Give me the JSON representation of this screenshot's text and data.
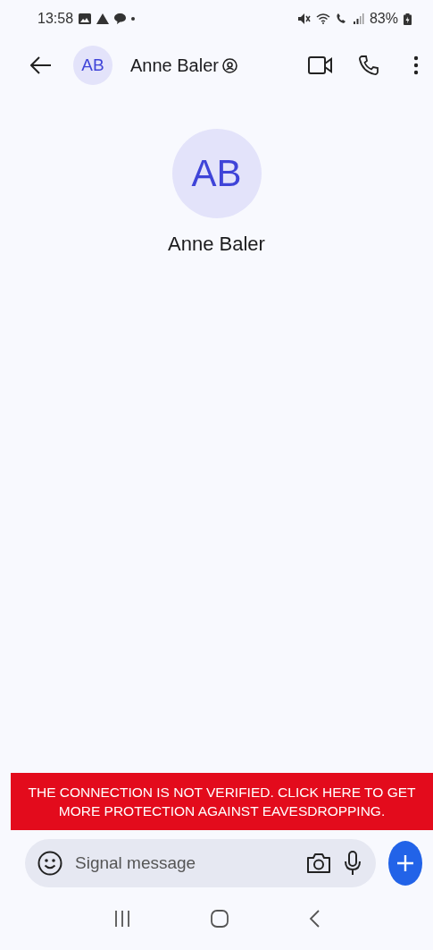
{
  "status_bar": {
    "time": "13:58",
    "battery": "83%"
  },
  "header": {
    "initials": "AB",
    "name": "Anne Baler"
  },
  "profile": {
    "initials": "AB",
    "name": "Anne Baler"
  },
  "banner": {
    "text": "THE CONNECTION IS NOT VERIFIED. CLICK HERE TO GET MORE PROTECTION AGAINST EAVESDROPPING."
  },
  "composer": {
    "placeholder": "Signal message"
  }
}
